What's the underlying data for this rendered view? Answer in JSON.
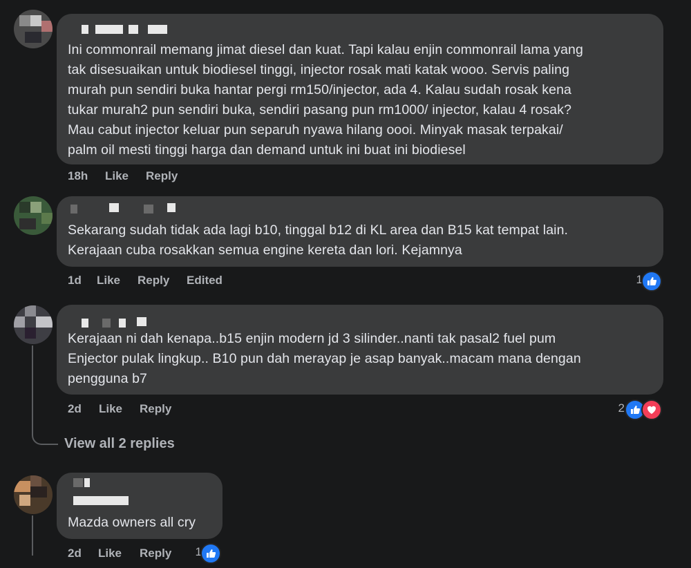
{
  "comments": [
    {
      "text": "Ini commonrail memang jimat diesel dan kuat. Tapi kalau enjin commonrail lama yang\ntak disesuaikan untuk biodiesel tinggi, injector rosak mati katak wooo. Servis paling\nmurah pun sendiri buka hantar pergi rm150/injector, ada 4. Kalau sudah rosak kena\ntukar murah2 pun sendiri buka, sendiri pasang pun rm1000/ injector, kalau 4 rosak?\nMau cabut injector keluar pun separuh nyawa hilang oooi. Minyak masak terpakai/\npalm oil mesti tinggi harga dan demand untuk ini buat ini biodiesel",
      "time": "18h",
      "like": "Like",
      "reply": "Reply"
    },
    {
      "text": "Sekarang sudah tidak ada lagi b10, tinggal b12 di KL area dan B15 kat tempat lain.\nKerajaan cuba rosakkan semua engine kereta dan lori. Kejamnya",
      "time": "1d",
      "like": "Like",
      "reply": "Reply",
      "edited": "Edited",
      "reaction_count": "1"
    },
    {
      "text": "Kerajaan ni dah kenapa..b15 enjin modern jd 3 silinder..nanti tak pasal2 fuel pum\nEnjector pulak lingkup.. B10 pun dah merayap je asap banyak..macam mana dengan\npengguna b7",
      "time": "2d",
      "like": "Like",
      "reply": "Reply",
      "reaction_count": "2",
      "view_replies": "View all 2 replies"
    },
    {
      "text": "Mazda owners all cry",
      "time": "2d",
      "like": "Like",
      "reply": "Reply",
      "reaction_count": "1"
    }
  ],
  "colors": {
    "background": "#18191a",
    "bubble": "#3a3b3c",
    "text": "#e4e6eb",
    "meta": "#b0b3b8",
    "like": "#2078f4",
    "love": "#f33e58"
  },
  "icons": [
    "like-icon",
    "love-icon"
  ]
}
